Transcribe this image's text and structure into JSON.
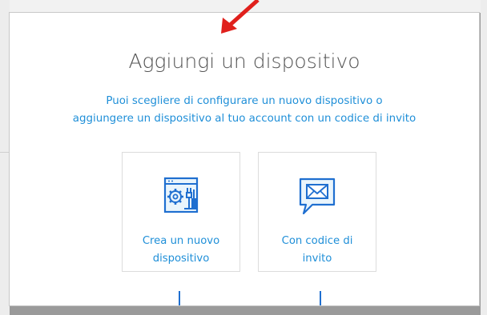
{
  "dialog": {
    "title": "Aggiungi un dispositivo",
    "subtitle_line1": "Puoi scegliere di configurare un nuovo dispositivo o",
    "subtitle_line2": "aggiungere un dispositivo al tuo account con un codice di invito"
  },
  "options": [
    {
      "icon": "device-settings-icon",
      "label_line1": "Crea un nuovo",
      "label_line2": "dispositivo"
    },
    {
      "icon": "envelope-message-icon",
      "label_line1": "Con codice di",
      "label_line2": "invito"
    }
  ],
  "colors": {
    "accent": "#1f8fd8",
    "title": "#555555",
    "arrow": "#e0201c",
    "connector": "#1f6fd0"
  }
}
